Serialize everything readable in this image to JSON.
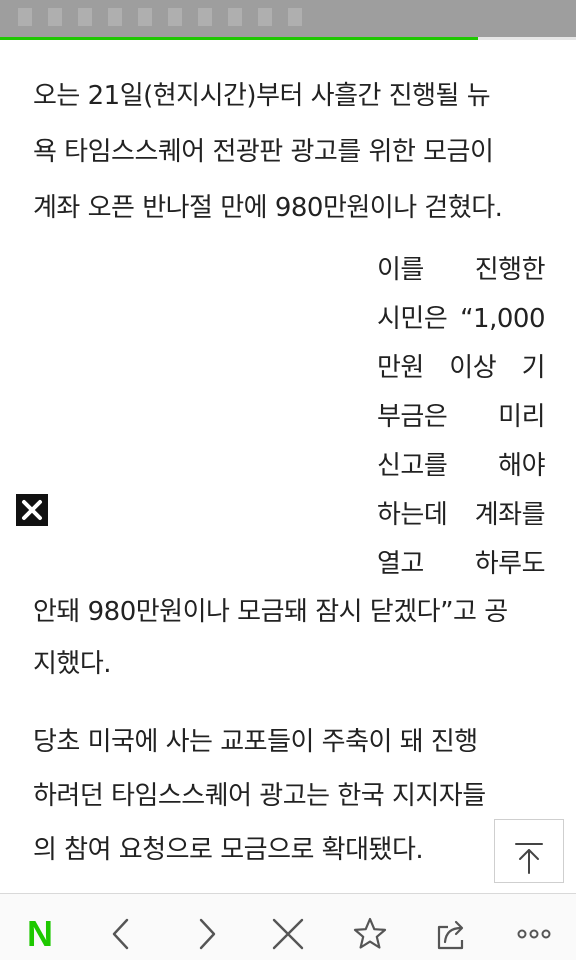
{
  "status_bar": {
    "page_load_progress": 0.83,
    "accent_color": "#1ec800"
  },
  "article": {
    "paragraph_1": [
      "오는 21일(현지시간)부터 사흘간 진행될 뉴",
      "욕 타임스스퀘어 전광판 광고를 위한 모금이",
      "계좌 오픈 반나절 만에 980만원이나 걷혔다."
    ],
    "paragraph_2_wrapped": [
      "이를 진행한",
      "시민은 “1,000",
      "만원 이상 기",
      "부금은 미리",
      "신고를 해야",
      "하는데 계좌를",
      "열고 하루도"
    ],
    "paragraph_2_full": [
      "안돼 980만원이나 모금돼 잠시 닫겠다”고 공",
      "지했다."
    ],
    "paragraph_3": [
      "당초 미국에 사는 교포들이 주축이 돼 진행",
      "하려던 타임스스퀘어 광고는 한국 지지자들",
      "의 참여 요청으로 모금으로 확대됐다."
    ]
  },
  "ad": {
    "close_icon": "close-icon"
  },
  "floating": {
    "scroll_top_icon": "arrow-up-to-top-icon"
  },
  "bottom_nav": {
    "home_logo": "N",
    "items": [
      {
        "icon": "chevron-left-icon"
      },
      {
        "icon": "chevron-right-icon"
      },
      {
        "icon": "close-icon"
      },
      {
        "icon": "star-icon"
      },
      {
        "icon": "share-icon"
      },
      {
        "icon": "more-icon"
      }
    ]
  }
}
